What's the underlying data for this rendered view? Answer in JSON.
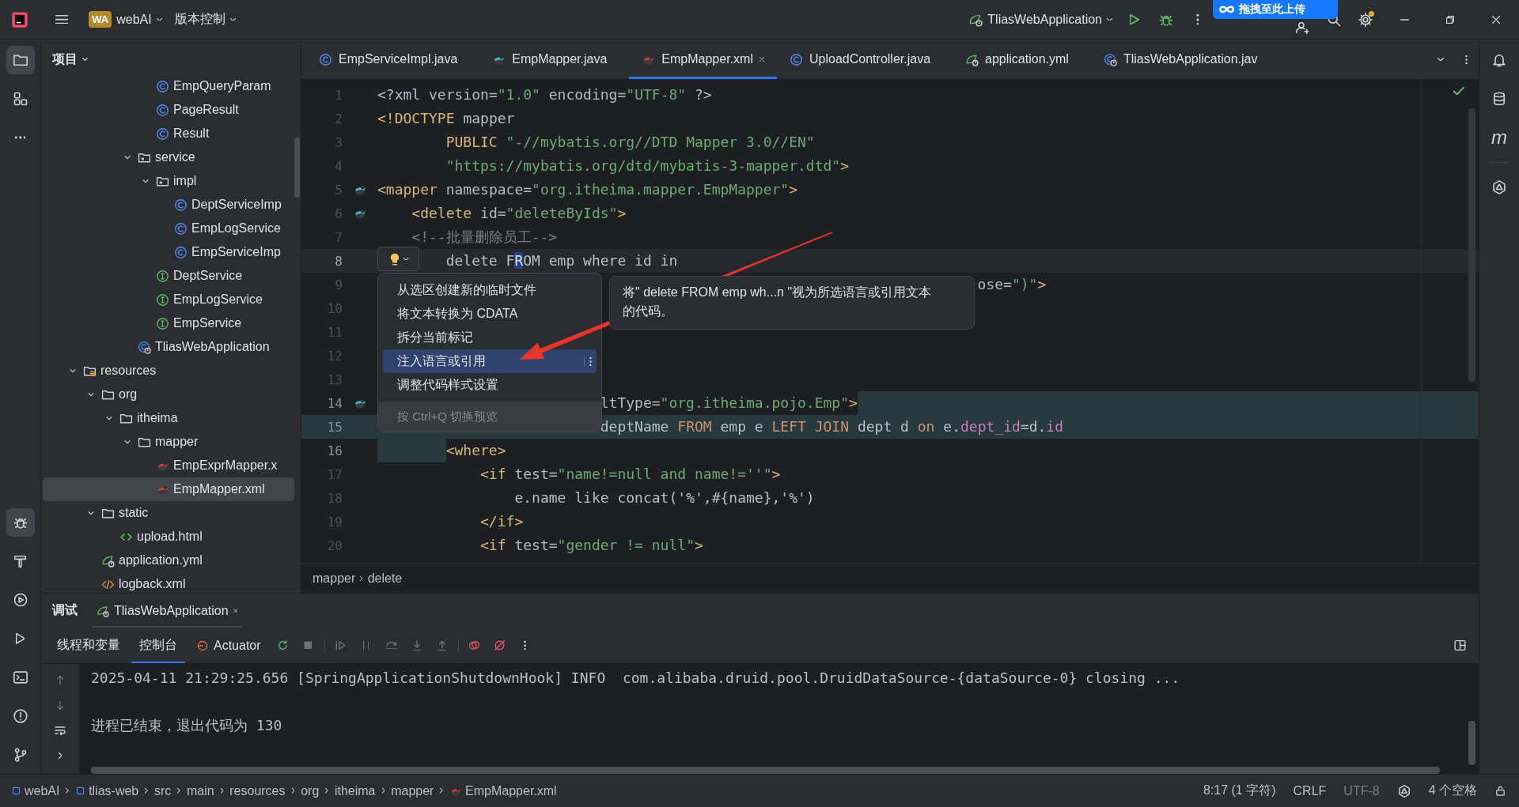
{
  "title_bar": {
    "project": {
      "badge": "WA",
      "name": "webAI"
    },
    "vcs": "版本控制",
    "run_config": "TliasWebApplication",
    "upload_widget": "拖拽至此上传"
  },
  "left_toolbar": {
    "top": [
      {
        "kind": "folder",
        "selected": true
      },
      {
        "kind": "structure",
        "selected": false
      },
      {
        "kind": "more",
        "selected": false
      }
    ],
    "bottom": [
      {
        "kind": "debug",
        "selected": true
      },
      {
        "kind": "build",
        "selected": false
      },
      {
        "kind": "services",
        "selected": false
      },
      {
        "kind": "run",
        "selected": false
      },
      {
        "kind": "terminal",
        "selected": false
      },
      {
        "kind": "problems",
        "selected": false
      },
      {
        "kind": "git",
        "selected": false
      }
    ]
  },
  "project_panel": {
    "title": "项目",
    "tree": [
      {
        "children": [
          {
            "children": [
              {
                "children": [
                  {
                    "children": [
                      {
                        "label": "EmpQueryParam",
                        "kind": "class",
                        "selected": false
                      },
                      {
                        "label": "PageResult",
                        "kind": "class",
                        "selected": false
                      },
                      {
                        "label": "Result",
                        "kind": "class",
                        "selected": false
                      }
                    ]
                  },
                  {
                    "label": "service",
                    "kind": "package",
                    "expanded": true,
                    "selected": false,
                    "children": [
                      {
                        "label": "impl",
                        "kind": "package",
                        "expanded": true,
                        "selected": false,
                        "children": [
                          {
                            "label": "DeptServiceImp",
                            "kind": "class",
                            "selected": false
                          },
                          {
                            "label": "EmpLogService",
                            "kind": "class",
                            "selected": false
                          },
                          {
                            "label": "EmpServiceImp",
                            "kind": "class",
                            "selected": false
                          }
                        ]
                      },
                      {
                        "label": "DeptService",
                        "kind": "interface",
                        "selected": false
                      },
                      {
                        "label": "EmpLogService",
                        "kind": "interface",
                        "selected": false
                      },
                      {
                        "label": "EmpService",
                        "kind": "interface",
                        "selected": false
                      }
                    ]
                  },
                  {
                    "label": "TliasWebApplication",
                    "kind": "app",
                    "selected": false
                  }
                ]
              }
            ]
          }
        ]
      },
      {
        "label": "resources",
        "kind": "resources",
        "expanded": true,
        "selected": false,
        "children": [
          {
            "label": "org",
            "kind": "folder",
            "expanded": true,
            "selected": false,
            "children": [
              {
                "label": "itheima",
                "kind": "folder",
                "expanded": true,
                "selected": false,
                "children": [
                  {
                    "label": "mapper",
                    "kind": "folder",
                    "expanded": true,
                    "selected": false,
                    "children": [
                      {
                        "label": "EmpExprMapper.x",
                        "kind": "mybatis",
                        "selected": false
                      },
                      {
                        "label": "EmpMapper.xml",
                        "kind": "mybatis",
                        "selected": true
                      }
                    ]
                  }
                ]
              }
            ]
          },
          {
            "label": "static",
            "kind": "folder",
            "expanded": true,
            "selected": false,
            "children": [
              {
                "label": "upload.html",
                "kind": "html",
                "selected": false
              }
            ]
          },
          {
            "label": "application.yml",
            "kind": "yml",
            "selected": false
          },
          {
            "label": "logback.xml",
            "kind": "xml",
            "selected": false
          }
        ]
      }
    ]
  },
  "editor": {
    "tabs": [
      {
        "label": "EmpServiceImpl.java",
        "kind": "class",
        "selected": false
      },
      {
        "label": "EmpMapper.java",
        "kind": "mybatis-java",
        "selected": false
      },
      {
        "label": "EmpMapper.xml",
        "kind": "mybatis",
        "selected": true
      },
      {
        "label": "UploadController.java",
        "kind": "class",
        "selected": false
      },
      {
        "label": "application.yml",
        "kind": "yml",
        "selected": false
      },
      {
        "label": "TliasWebApplication.jav",
        "kind": "app",
        "selected": false
      }
    ],
    "lines": [
      {
        "number": "1",
        "kind": "normal",
        "tokens": [
          {
            "text": "<?xml",
            "kind": "plain"
          },
          {
            "text": " version=",
            "kind": "attr"
          },
          {
            "text": "\"1.0\"",
            "kind": "str"
          },
          {
            "text": " encoding=",
            "kind": "attr"
          },
          {
            "text": "\"UTF-8\"",
            "kind": "str"
          },
          {
            "text": " ?>",
            "kind": "plain"
          }
        ]
      },
      {
        "number": "2",
        "kind": "normal",
        "tokens": [
          {
            "text": "<!DOCTYPE",
            "kind": "tag"
          },
          {
            "text": " mapper",
            "kind": "plain"
          }
        ]
      },
      {
        "number": "3",
        "kind": "normal",
        "tokens": [
          {
            "text": "        PUBLIC",
            "kind": "tag"
          },
          {
            "text": " \"-//mybatis.org//DTD Mapper 3.0//EN\"",
            "kind": "str"
          }
        ]
      },
      {
        "number": "4",
        "kind": "normal",
        "tokens": [
          {
            "text": "        \"https://mybatis.org/dtd/mybatis-3-mapper.dtd\"",
            "kind": "str"
          },
          {
            "text": ">",
            "kind": "tag"
          }
        ]
      },
      {
        "number": "5",
        "kind": "normal",
        "marker": true,
        "tokens": [
          {
            "text": "<mapper",
            "kind": "tag"
          },
          {
            "text": " namespace=",
            "kind": "attr"
          },
          {
            "text": "\"org.itheima.mapper.EmpMapper\"",
            "kind": "str"
          },
          {
            "text": ">",
            "kind": "tag"
          }
        ]
      },
      {
        "number": "6",
        "kind": "normal",
        "marker": true,
        "tokens": [
          {
            "text": "    <delete",
            "kind": "tag"
          },
          {
            "text": " id=",
            "kind": "attr"
          },
          {
            "text": "\"deleteByIds\"",
            "kind": "str"
          },
          {
            "text": ">",
            "kind": "tag"
          }
        ]
      },
      {
        "number": "7",
        "kind": "normal",
        "tokens": [
          {
            "text": "    <!--批量删除员工-->",
            "kind": "comment"
          }
        ]
      },
      {
        "number": "8",
        "kind": "current",
        "tokens": [
          {
            "text": "        delete F",
            "kind": "plain"
          },
          {
            "text": "R",
            "kind": "match"
          },
          {
            "text": "OM emp where id in",
            "kind": "plain"
          }
        ]
      },
      {
        "number": "9",
        "kind": "normal",
        "tokens": [
          {
            "text": "                                                                      ose=",
            "kind": "attr"
          },
          {
            "text": "\")\"",
            "kind": "str"
          },
          {
            "text": ">",
            "kind": "tag"
          }
        ]
      },
      {
        "number": "10",
        "kind": "normal"
      },
      {
        "number": "11",
        "kind": "normal"
      },
      {
        "number": "12",
        "kind": "normal"
      },
      {
        "number": "13",
        "kind": "normal"
      },
      {
        "number": "14",
        "kind": "selection-tail",
        "marker": true,
        "tokens": [
          {
            "text": "                          ltType=",
            "kind": "attr"
          },
          {
            "text": "\"org.itheima.pojo.Emp\"",
            "kind": "str"
          },
          {
            "text": ">",
            "kind": "tag"
          }
        ]
      },
      {
        "number": "15",
        "kind": "selection-full",
        "tokens": [
          {
            "text": "                          deptName ",
            "kind": "plain"
          },
          {
            "text": "FROM",
            "kind": "kw"
          },
          {
            "text": " emp e ",
            "kind": "plain"
          },
          {
            "text": "LEFT JOIN",
            "kind": "kw"
          },
          {
            "text": " dept d ",
            "kind": "plain"
          },
          {
            "text": "on",
            "kind": "kw"
          },
          {
            "text": " e.",
            "kind": "plain"
          },
          {
            "text": "dept_id",
            "kind": "field"
          },
          {
            "text": "=d.",
            "kind": "plain"
          },
          {
            "text": "id",
            "kind": "field"
          }
        ]
      },
      {
        "number": "16",
        "kind": "selection-indent",
        "tokens": [
          {
            "text": "        <where>",
            "kind": "tag"
          }
        ]
      },
      {
        "number": "17",
        "kind": "normal",
        "tokens": [
          {
            "text": "            <if",
            "kind": "tag"
          },
          {
            "text": " test=",
            "kind": "attr"
          },
          {
            "text": "\"name!=null and name!=''\"",
            "kind": "str"
          },
          {
            "text": ">",
            "kind": "tag"
          }
        ]
      },
      {
        "number": "18",
        "kind": "normal",
        "tokens": [
          {
            "text": "                e.name like concat('%',#{name},'%')",
            "kind": "plain"
          }
        ]
      },
      {
        "number": "19",
        "kind": "normal",
        "tokens": [
          {
            "text": "            </if>",
            "kind": "tag"
          }
        ]
      },
      {
        "number": "20",
        "kind": "normal",
        "tokens": [
          {
            "text": "            <if",
            "kind": "tag"
          },
          {
            "text": " test=",
            "kind": "attr"
          },
          {
            "text": "\"gender != null\"",
            "kind": "str"
          },
          {
            "text": ">",
            "kind": "tag"
          }
        ]
      }
    ],
    "intention_popup": {
      "items": [
        {
          "label": "从选区创建新的临时文件",
          "selected": false
        },
        {
          "label": "将文本转换为 CDATA",
          "selected": false
        },
        {
          "label": "拆分当前标记",
          "selected": false
        },
        {
          "label": "注入语言或引用",
          "selected": true
        },
        {
          "label": "调整代码样式设置",
          "selected": false
        }
      ],
      "footer": "按 Ctrl+Q 切换预览"
    },
    "tooltip": "将\" delete FROM emp wh...n \"视为所选语言或引用文本的代码。",
    "breadcrumb": [
      "mapper",
      "delete"
    ]
  },
  "right_toolbar": {
    "maven": "m"
  },
  "debug_panel": {
    "title": "调试",
    "session_tab": "TliasWebApplication",
    "tabs": [
      {
        "label": "线程和变量",
        "selected": false,
        "kind": "text"
      },
      {
        "label": "控制台",
        "selected": true,
        "kind": "text"
      },
      {
        "label": "Actuator",
        "selected": false,
        "kind": "actuator"
      }
    ],
    "console": [
      {
        "text": "2025-04-11 21:29:25.656 [SpringApplicationShutdownHook] INFO  com.alibaba.druid.pool.DruidDataSource-{dataSource-0} closing ...",
        "kind": "log"
      },
      {
        "text": "进程已结束，退出代码为 130",
        "kind": "exit"
      }
    ]
  },
  "status_bar": {
    "path": [
      {
        "label": "webAI",
        "kind": "module"
      },
      {
        "label": "tlias-web",
        "kind": "module"
      },
      {
        "label": "src",
        "kind": "dir"
      },
      {
        "label": "main",
        "kind": "dir"
      },
      {
        "label": "resources",
        "kind": "dir"
      },
      {
        "label": "org",
        "kind": "dir"
      },
      {
        "label": "itheima",
        "kind": "dir"
      },
      {
        "label": "mapper",
        "kind": "dir"
      },
      {
        "label": "EmpMapper.xml",
        "kind": "file"
      }
    ],
    "position": "8:17 (1 字符)",
    "line_separator": "CRLF",
    "encoding": "UTF-8",
    "indent": "4 个空格"
  }
}
